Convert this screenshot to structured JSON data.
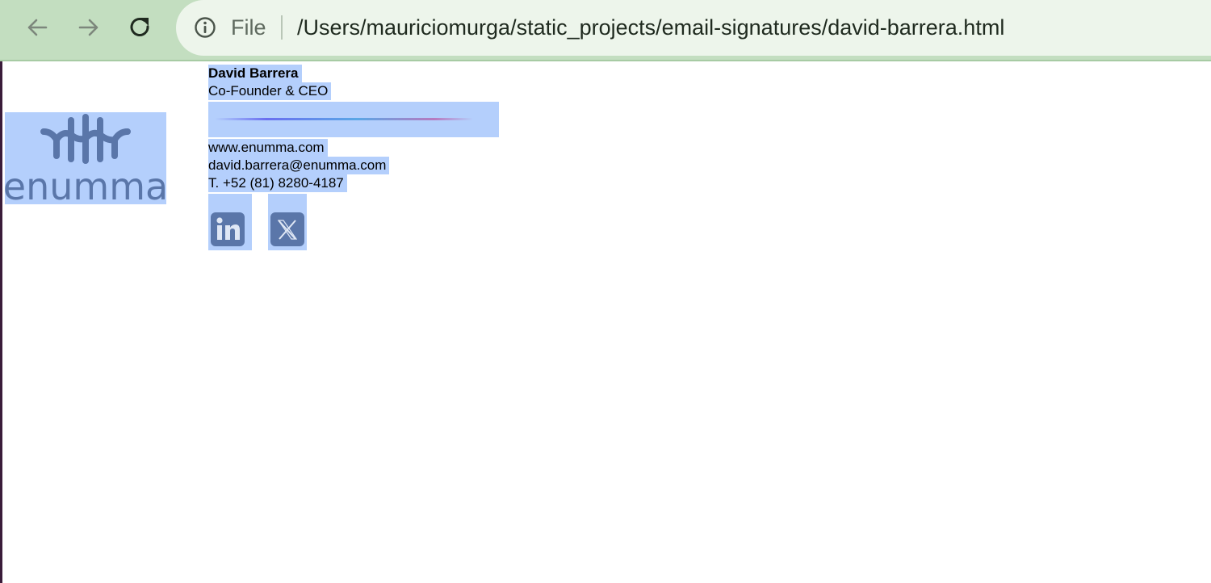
{
  "browser": {
    "nav": {
      "back_icon": "arrow-left-icon",
      "forward_icon": "arrow-right-icon",
      "reload_icon": "reload-icon"
    },
    "omnibox": {
      "info_icon": "info-icon",
      "scheme_label": "File",
      "url": "/Users/mauriciomurga/static_projects/email-signatures/david-barrera.html"
    },
    "colors": {
      "toolbar": "#c3dec0",
      "omnibox": "#edf5eb",
      "selection": "#b4cffc"
    }
  },
  "signature": {
    "logo": {
      "alt": "enumma",
      "wordmark": "enumma",
      "color": "#5a76a9"
    },
    "name": "David Barrera",
    "title": "Co-Founder & CEO",
    "website": "www.enumma.com",
    "email": "david.barrera@enumma.com",
    "phone": "T. +52 (81) 8280-4187",
    "social": [
      {
        "name": "LinkedIn",
        "icon": "linkedin-icon"
      },
      {
        "name": "X",
        "icon": "x-icon"
      }
    ]
  }
}
